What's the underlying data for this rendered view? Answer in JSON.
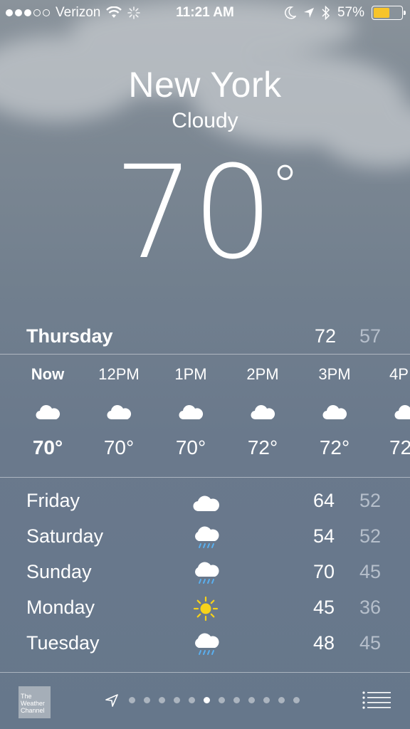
{
  "status_bar": {
    "carrier": "Verizon",
    "signal_bars_filled": 3,
    "signal_bars_total": 5,
    "time": "11:21 AM",
    "battery_percent": "57%",
    "battery_level": 0.57,
    "icons": [
      "wifi-icon",
      "activity-spinner-icon",
      "moon-icon",
      "location-arrow-icon",
      "bluetooth-icon",
      "battery-icon"
    ]
  },
  "current": {
    "city": "New York",
    "condition": "Cloudy",
    "temperature": "70",
    "degree_symbol": "°"
  },
  "today": {
    "day": "Thursday",
    "high": "72",
    "low": "57"
  },
  "hourly": [
    {
      "label": "Now",
      "icon": "cloud-icon",
      "temp": "70°"
    },
    {
      "label": "12PM",
      "icon": "cloud-icon",
      "temp": "70°"
    },
    {
      "label": "1PM",
      "icon": "cloud-icon",
      "temp": "70°"
    },
    {
      "label": "2PM",
      "icon": "cloud-icon",
      "temp": "72°"
    },
    {
      "label": "3PM",
      "icon": "cloud-icon",
      "temp": "72°"
    },
    {
      "label": "4P",
      "icon": "cloud-icon",
      "temp": "72"
    }
  ],
  "daily": [
    {
      "day": "Friday",
      "icon": "cloud-icon",
      "high": "64",
      "low": "52"
    },
    {
      "day": "Saturday",
      "icon": "rain-cloud-icon",
      "high": "54",
      "low": "52"
    },
    {
      "day": "Sunday",
      "icon": "rain-cloud-icon",
      "high": "70",
      "low": "45"
    },
    {
      "day": "Monday",
      "icon": "sun-icon",
      "high": "45",
      "low": "36"
    },
    {
      "day": "Tuesday",
      "icon": "rain-cloud-icon",
      "high": "48",
      "low": "45"
    }
  ],
  "bottom_bar": {
    "logo_text": [
      "The",
      "Weather",
      "Channel"
    ],
    "page_count": 12,
    "active_page": 5
  },
  "colors": {
    "low_temp": "#b6bfcb",
    "battery": "#f7c42a",
    "sun": "#f7d21a",
    "rain": "#5ab0f0"
  }
}
